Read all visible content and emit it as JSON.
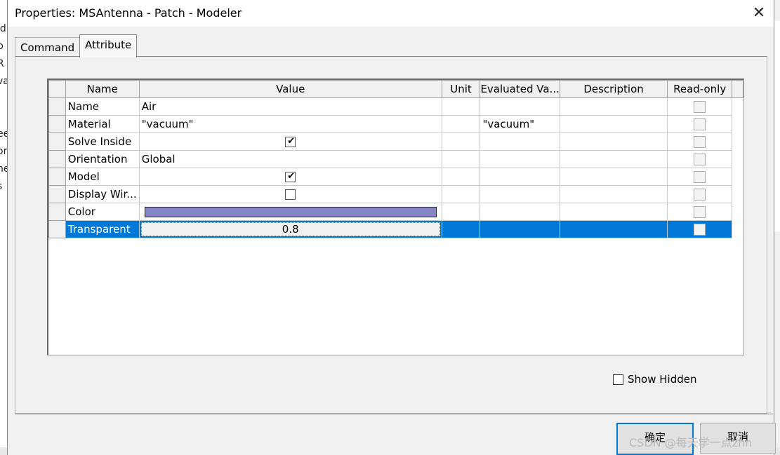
{
  "dialog": {
    "title": "Properties: MSAntenna - Patch - Modeler",
    "close_glyph": "✕"
  },
  "tabs": [
    "Command",
    "Attribute"
  ],
  "grid": {
    "columns": [
      "Name",
      "Value",
      "Unit",
      "Evaluated Va...",
      "Description",
      "Read-only"
    ],
    "rows": [
      {
        "name": "Name",
        "value": "Air",
        "unit": "",
        "evaluated": "",
        "description": ""
      },
      {
        "name": "Material",
        "value": "\"vacuum\"",
        "unit": "",
        "evaluated": "\"vacuum\"",
        "description": ""
      },
      {
        "name": "Solve Inside",
        "value": "",
        "unit": "",
        "evaluated": "",
        "description": ""
      },
      {
        "name": "Orientation",
        "value": "Global",
        "unit": "",
        "evaluated": "",
        "description": ""
      },
      {
        "name": "Model",
        "value": "",
        "unit": "",
        "evaluated": "",
        "description": ""
      },
      {
        "name": "Display Wir...",
        "value": "",
        "unit": "",
        "evaluated": "",
        "description": ""
      },
      {
        "name": "Color",
        "value": "",
        "unit": "",
        "evaluated": "",
        "description": ""
      },
      {
        "name": "Transparent",
        "value": "0.8",
        "unit": "",
        "evaluated": "",
        "description": ""
      }
    ],
    "color_swatch": "#8585c6",
    "selection_color": "#0078d7"
  },
  "show_hidden_label": "Show Hidden",
  "buttons": {
    "ok": "确定",
    "cancel": "取消"
  },
  "watermark": "CSDN @每天学一点zhn",
  "background_fragments": [
    "id",
    "p",
    "R",
    "va",
    "",
    "ee",
    "or",
    "ne",
    "s"
  ]
}
